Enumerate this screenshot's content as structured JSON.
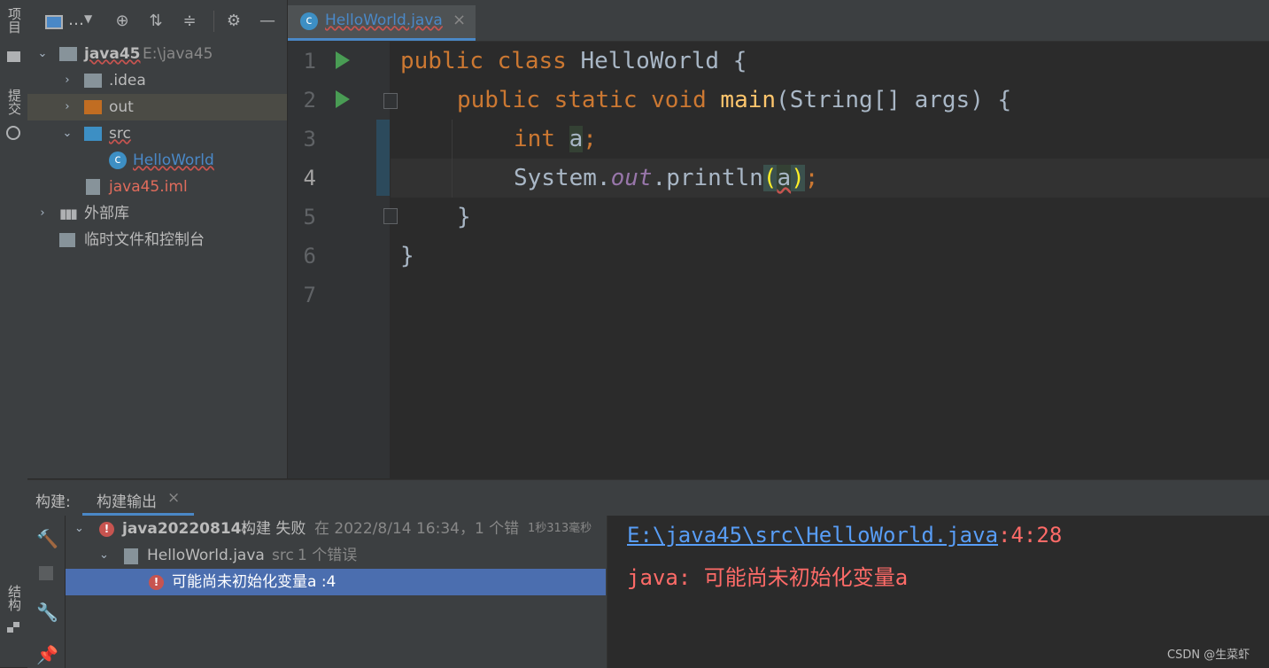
{
  "left_strip": {
    "project_label": "项目",
    "commit_label": "提交",
    "structure_label": "结构"
  },
  "project_toolbar": {
    "view_label": "…"
  },
  "tree": [
    {
      "label": "java45",
      "path": "E:\\java45"
    },
    {
      "label": ".idea"
    },
    {
      "label": "out"
    },
    {
      "label": "src"
    },
    {
      "label": "HelloWorld"
    },
    {
      "label": "java45.iml"
    },
    {
      "label": "外部库"
    },
    {
      "label": "临时文件和控制台"
    }
  ],
  "tab": {
    "label": "HelloWorld.java",
    "close": "×"
  },
  "line_numbers": [
    "1",
    "2",
    "3",
    "4",
    "5",
    "6",
    "7"
  ],
  "code": {
    "l1": {
      "kw": "public class ",
      "name": "HelloWorld",
      "rest": " {"
    },
    "l2": {
      "kw": "public static void ",
      "fn": "main",
      "rest": "(String[] args) {"
    },
    "l3": {
      "kw": "int ",
      "var": "a",
      "semi": ";"
    },
    "l4": {
      "sys": "System.",
      "field": "out",
      "call": ".println",
      "open": "(",
      "arg": "a",
      "close": ")",
      "semi": ";"
    },
    "l5": {
      "text": "}"
    },
    "l6": {
      "text": "}"
    }
  },
  "build": {
    "tab_prefix": "构建:",
    "tab_label": "构建输出",
    "tab_close": "×",
    "root": {
      "name": "java20220814:",
      "status": "构建 失败",
      "detail": "在 2022/8/14 16:34，1 个错",
      "duration": "1秒313毫秒"
    },
    "file": {
      "name": "HelloWorld.java",
      "dir": "src",
      "count": "1 个错误"
    },
    "error": {
      "text": "可能尚未初始化变量a :4"
    }
  },
  "console": {
    "link": "E:\\java45\\src\\HelloWorld.java",
    "pos": ":4:28",
    "message": "java: 可能尚未初始化变量a"
  },
  "watermark": "CSDN @生菜虾",
  "colors": {
    "accent": "#4a88c7",
    "error": "#c75450",
    "keyword": "#cc7832",
    "function": "#ffc66d",
    "selection": "#4b6eaf"
  }
}
